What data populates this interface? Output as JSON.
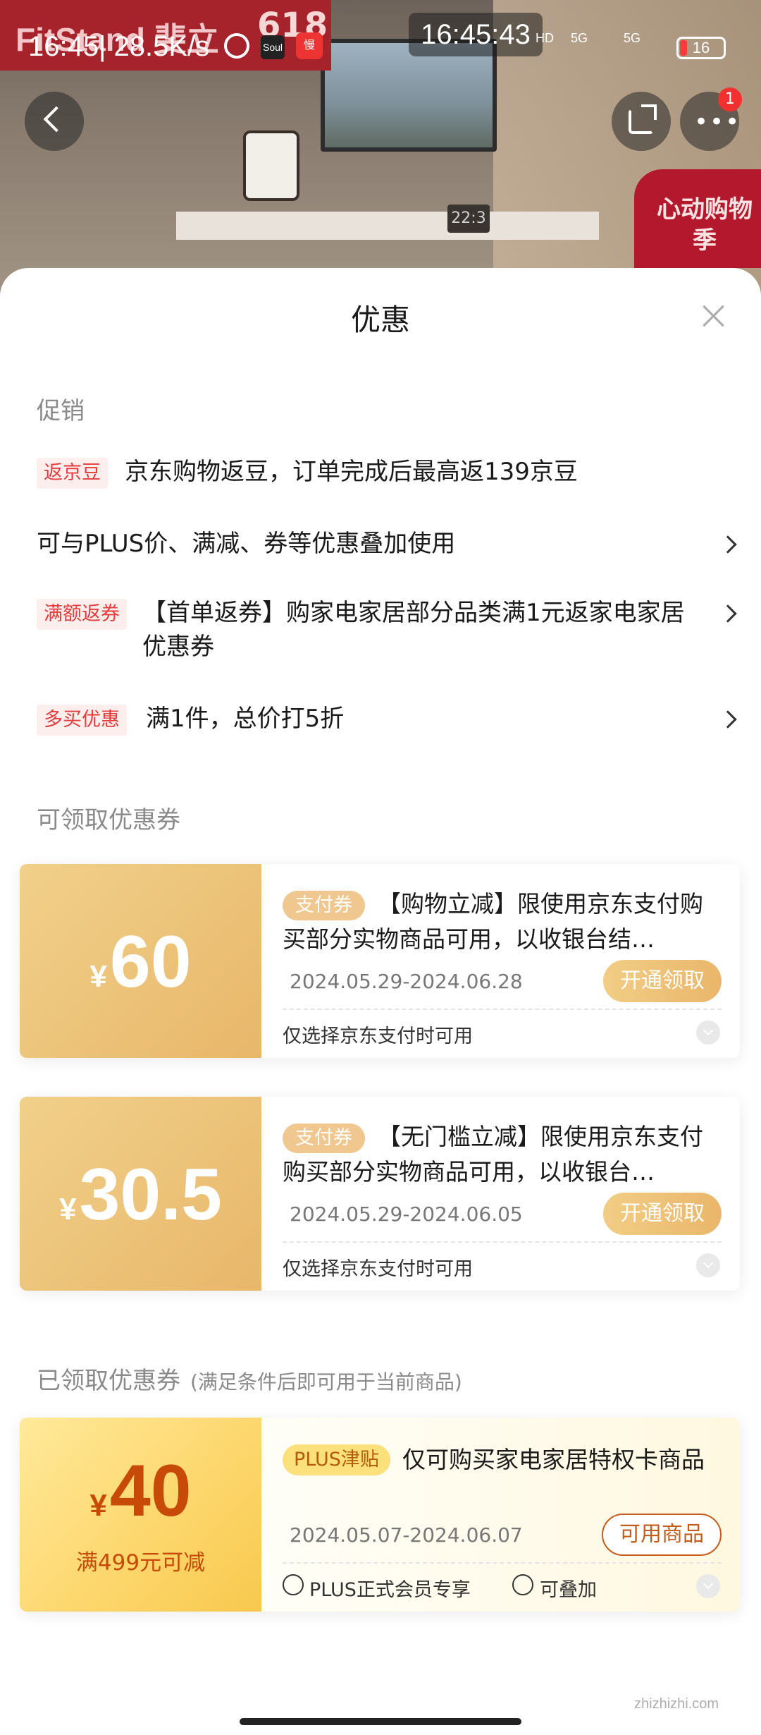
{
  "status_bar": {
    "time": "16:45",
    "net_rate": "28.5K/s",
    "center_time": "16:45:43",
    "signal_1": "5G",
    "signal_2": "5G",
    "battery": "16",
    "app1": "Soul",
    "app2": "慢"
  },
  "hero": {
    "brand": "FitStand 斐立",
    "event_badge": "618",
    "promo_corner": "心动购物季",
    "clock": "22:3",
    "more_badge_count": "1"
  },
  "sheet": {
    "title": "优惠"
  },
  "promotions": {
    "label": "促销",
    "items": [
      {
        "tag": "返京豆",
        "text": "京东购物返豆，订单完成后最高返139京豆"
      },
      {
        "tag": "",
        "text": "可与PLUS价、满减、券等优惠叠加使用"
      },
      {
        "tag": "满额返券",
        "text": "【首单返券】购家电家居部分品类满1元返家电家居优惠券"
      },
      {
        "tag": "多买优惠",
        "text": "满1件，总价打5折"
      }
    ]
  },
  "available_coupons": {
    "label": "可领取优惠券",
    "items": [
      {
        "currency": "¥",
        "amount": "60",
        "tag": "支付券",
        "desc": "【购物立减】限使用京东支付购买部分实物商品可用，以收银台结…",
        "date": "2024.05.29-2024.06.28",
        "button": "开通领取",
        "note": "仅选择京东支付时可用"
      },
      {
        "currency": "¥",
        "amount": "30.5",
        "tag": "支付券",
        "desc": "【无门槛立减】限使用京东支付购买部分实物商品可用，以收银台…",
        "date": "2024.05.29-2024.06.05",
        "button": "开通领取",
        "note": "仅选择京东支付时可用"
      }
    ]
  },
  "owned_coupons": {
    "label": "已领取优惠券",
    "sublabel": "(满足条件后即可用于当前商品)",
    "items": [
      {
        "currency": "¥",
        "amount": "40",
        "condition": "满499元可减",
        "tag": "PLUS津贴",
        "desc": "仅可购买家电家居特权卡商品",
        "date": "2024.05.07-2024.06.07",
        "button": "可用商品",
        "meta_1": "PLUS正式会员专享",
        "meta_2": "可叠加"
      }
    ]
  },
  "watermark": "zhizhizhi.com"
}
